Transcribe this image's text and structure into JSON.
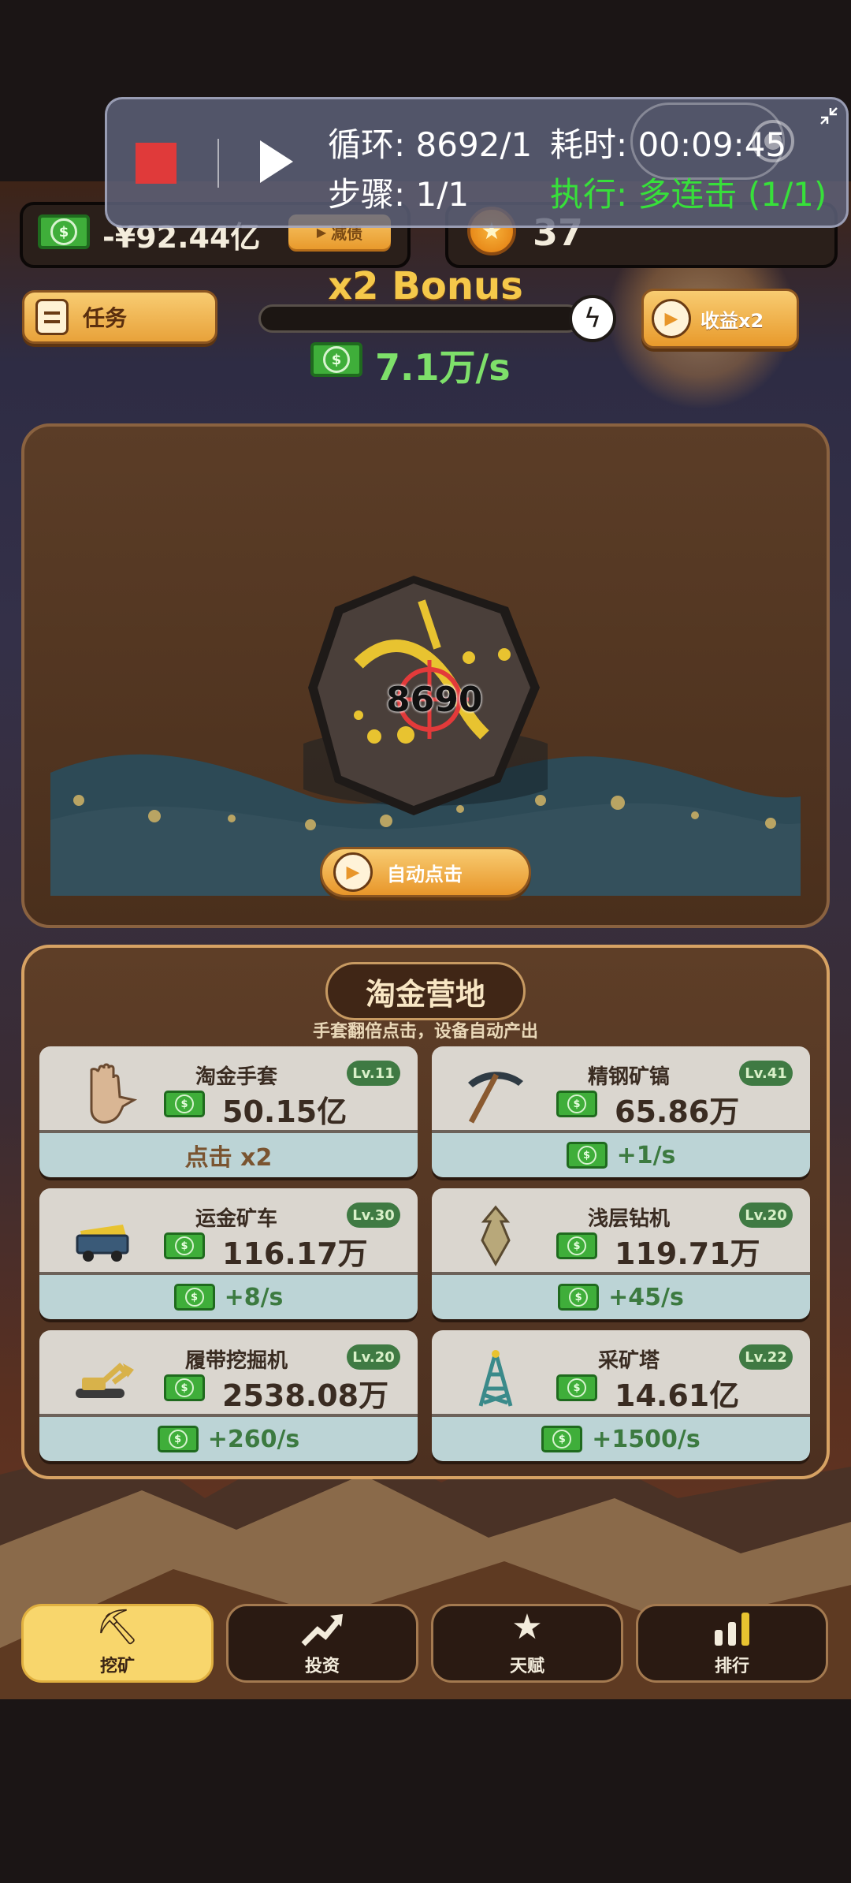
{
  "status": {
    "money": "-¥92.44亿",
    "debt_button": "减债",
    "coins": "37"
  },
  "bonus": {
    "title": "x2 Bonus",
    "progress": 0.0,
    "rate": "7.1万/s"
  },
  "buttons": {
    "tasks": "任务",
    "earn_x2": "收益x2",
    "auto_click": "自动点击"
  },
  "mine": {
    "click_count": "8690"
  },
  "camp": {
    "title": "淘金营地",
    "subtitle": "手套翻倍点击，设备自动产出",
    "items": [
      {
        "name": "淘金手套",
        "level": "Lv.11",
        "price": "50.15亿",
        "effect": "点击 x2",
        "icon": "glove-icon"
      },
      {
        "name": "精钢矿镐",
        "level": "Lv.41",
        "price": "65.86万",
        "effect": "+1/s",
        "icon": "pickaxe-icon"
      },
      {
        "name": "运金矿车",
        "level": "Lv.30",
        "price": "116.17万",
        "effect": "+8/s",
        "icon": "mine-cart-icon"
      },
      {
        "name": "浅层钻机",
        "level": "Lv.20",
        "price": "119.71万",
        "effect": "+45/s",
        "icon": "drill-icon"
      },
      {
        "name": "履带挖掘机",
        "level": "Lv.20",
        "price": "2538.08万",
        "effect": "+260/s",
        "icon": "excavator-icon"
      },
      {
        "name": "采矿塔",
        "level": "Lv.22",
        "price": "14.61亿",
        "effect": "+1500/s",
        "icon": "mining-tower-icon"
      }
    ]
  },
  "nav": [
    {
      "label": "挖矿",
      "icon": "pickaxe-icon",
      "active": true
    },
    {
      "label": "投资",
      "icon": "trend-up-icon",
      "active": false
    },
    {
      "label": "天赋",
      "icon": "star-icon",
      "active": false
    },
    {
      "label": "排行",
      "icon": "bar-chart-icon",
      "active": false
    }
  ],
  "overlay": {
    "loop": "循环: 8692/1",
    "elapsed": "耗时: 00:09:45",
    "step": "步骤: 1/1",
    "action": "执行: 多连击 (1/1)"
  },
  "colors": {
    "accent": "#f5c84a",
    "money_green": "#7ee06a",
    "overlay_action": "#37e03a"
  }
}
